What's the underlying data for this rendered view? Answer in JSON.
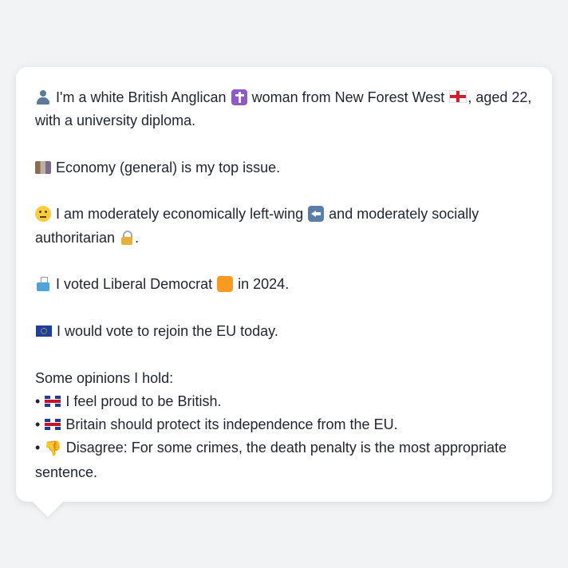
{
  "profile": {
    "intro": "I'm a white British Anglican",
    "intro_mid": "woman from New Forest West",
    "intro_end": ", aged 22, with a university diploma.",
    "issue": "Economy (general) is my top issue.",
    "ideology_a": "I am moderately economically left-wing",
    "ideology_b": "and moderately socially authoritarian",
    "ideology_end": ".",
    "vote_a": "I voted Liberal Democrat",
    "vote_b": "in 2024.",
    "eu": "I would vote to rejoin the EU today.",
    "opinions_heading": "Some opinions I hold:",
    "opinions": [
      "I feel proud to be British.",
      "Britain should protect its independence from the EU.",
      "Disagree: For some crimes, the death penalty is the most appropriate sentence."
    ],
    "bullet": "•"
  },
  "icons": {
    "person": "person-silhouette-icon",
    "religion": "latin-cross-icon",
    "region": "england-flag-icon",
    "issue": "map-icon",
    "ideology": "thinking-face-icon",
    "econ": "left-arrow-icon",
    "social": "lock-icon",
    "vote": "ballot-box-icon",
    "party": "orange-square-icon",
    "eu": "eu-flag-icon",
    "uk": "uk-flag-icon",
    "thumbs_down": "thumbs-down-icon"
  },
  "colors": {
    "background": "#f2f3f5",
    "card": "#ffffff",
    "text": "#1f2430",
    "party": "#f79a1f"
  }
}
